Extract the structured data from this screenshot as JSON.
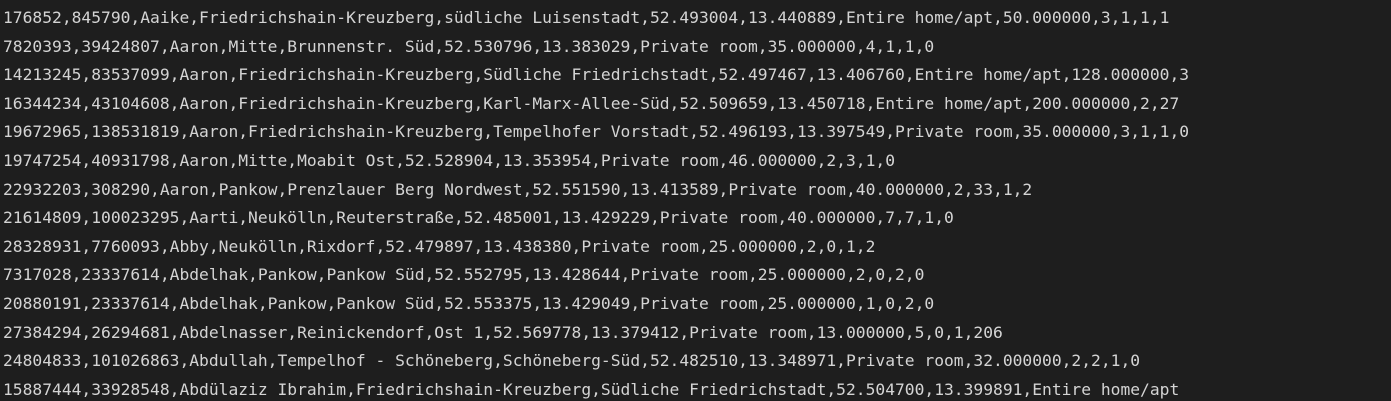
{
  "editor": {
    "lines": [
      "176852,845790,Aaike,Friedrichshain-Kreuzberg,südliche Luisenstadt,52.493004,13.440889,Entire home/apt,50.000000,3,1,1,1",
      "7820393,39424807,Aaron,Mitte,Brunnenstr. Süd,52.530796,13.383029,Private room,35.000000,4,1,1,0",
      "14213245,83537099,Aaron,Friedrichshain-Kreuzberg,Südliche Friedrichstadt,52.497467,13.406760,Entire home/apt,128.000000,3",
      "16344234,43104608,Aaron,Friedrichshain-Kreuzberg,Karl-Marx-Allee-Süd,52.509659,13.450718,Entire home/apt,200.000000,2,27",
      "19672965,138531819,Aaron,Friedrichshain-Kreuzberg,Tempelhofer Vorstadt,52.496193,13.397549,Private room,35.000000,3,1,1,0",
      "19747254,40931798,Aaron,Mitte,Moabit Ost,52.528904,13.353954,Private room,46.000000,2,3,1,0",
      "22932203,308290,Aaron,Pankow,Prenzlauer Berg Nordwest,52.551590,13.413589,Private room,40.000000,2,33,1,2",
      "21614809,100023295,Aarti,Neukölln,Reuterstraße,52.485001,13.429229,Private room,40.000000,7,7,1,0",
      "28328931,7760093,Abby,Neukölln,Rixdorf,52.479897,13.438380,Private room,25.000000,2,0,1,2",
      "7317028,23337614,Abdelhak,Pankow,Pankow Süd,52.552795,13.428644,Private room,25.000000,2,0,2,0",
      "20880191,23337614,Abdelhak,Pankow,Pankow Süd,52.553375,13.429049,Private room,25.000000,1,0,2,0",
      "27384294,26294681,Abdelnasser,Reinickendorf,Ost 1,52.569778,13.379412,Private room,13.000000,5,0,1,206",
      "24804833,101026863,Abdullah,Tempelhof - Schöneberg,Schöneberg-Süd,52.482510,13.348971,Private room,32.000000,2,2,1,0",
      "15887444,33928548,Abdülaziz Ibrahim,Friedrichshain-Kreuzberg,Südliche Friedrichstadt,52.504700,13.399891,Entire home/apt"
    ]
  }
}
